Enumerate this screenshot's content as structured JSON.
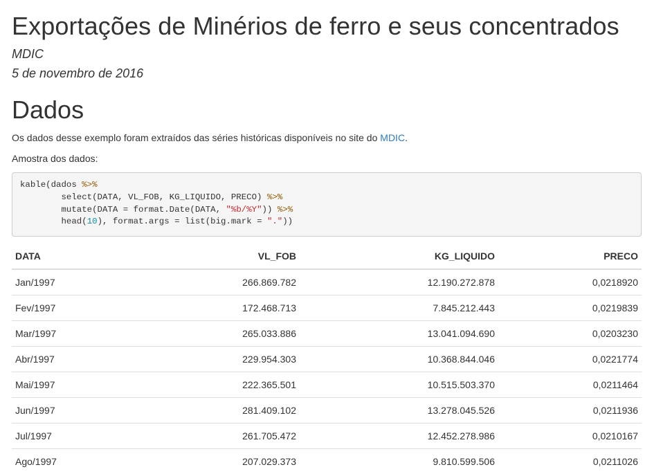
{
  "document": {
    "title": "Exportações de Minérios de ferro e seus concentrados",
    "author": "MDIC",
    "date": "5 de novembro de 2016"
  },
  "section": {
    "heading": "Dados",
    "intro_text": "Os dados desse exemplo foram extraídos das séries históricas disponíveis no site do ",
    "intro_link": "MDIC",
    "intro_end": ".",
    "sample_label": "Amostra dos dados:"
  },
  "code": {
    "line1_a": "kable(dados ",
    "line1_op": "%>%",
    "line2_indent": "        ",
    "line2_a": "select(DATA, VL_FOB, KG_LIQUIDO, PRECO) ",
    "line2_op": "%>%",
    "line3_a": "mutate(DATA = format.Date(DATA, ",
    "line3_str": "\"%b/%Y\"",
    "line3_b": ")) ",
    "line3_op": "%>%",
    "line4_a": "head(",
    "line4_num": "10",
    "line4_b": "), format.args = list(big.mark = ",
    "line4_str": "\".\"",
    "line4_c": "))"
  },
  "table": {
    "headers": [
      "DATA",
      "VL_FOB",
      "KG_LIQUIDO",
      "PRECO"
    ],
    "rows": [
      [
        "Jan/1997",
        "266.869.782",
        "12.190.272.878",
        "0,0218920"
      ],
      [
        "Fev/1997",
        "172.468.713",
        "7.845.212.443",
        "0,0219839"
      ],
      [
        "Mar/1997",
        "265.033.886",
        "13.041.094.690",
        "0,0203230"
      ],
      [
        "Abr/1997",
        "229.954.303",
        "10.368.844.046",
        "0,0221774"
      ],
      [
        "Mai/1997",
        "222.365.501",
        "10.515.503.370",
        "0,0211464"
      ],
      [
        "Jun/1997",
        "281.409.102",
        "13.278.045.526",
        "0,0211936"
      ],
      [
        "Jul/1997",
        "261.705.472",
        "12.452.278.986",
        "0,0210167"
      ],
      [
        "Ago/1997",
        "207.029.373",
        "9.810.599.506",
        "0,0211026"
      ]
    ]
  }
}
